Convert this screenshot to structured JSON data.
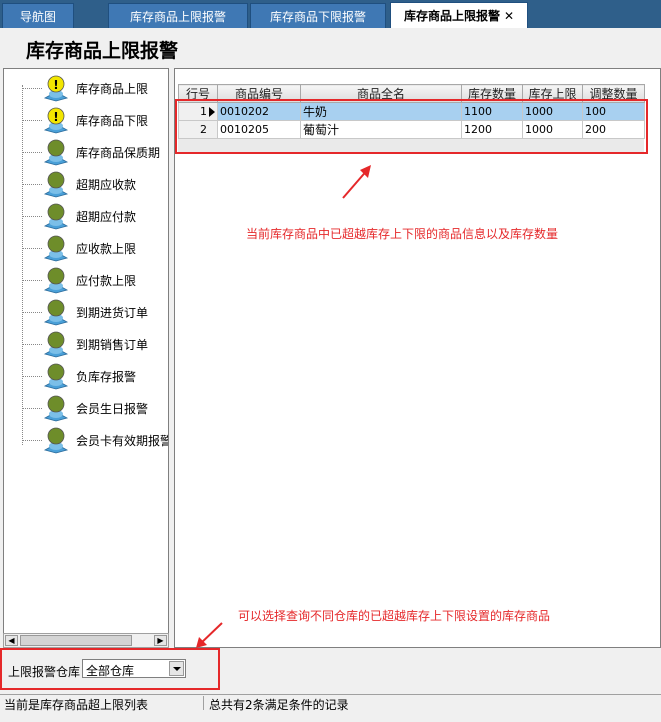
{
  "tabs": [
    {
      "label": "导航图"
    },
    {
      "label": "库存商品上限报警"
    },
    {
      "label": "库存商品下限报警"
    },
    {
      "label": "库存商品上限报警",
      "close": "✕"
    }
  ],
  "page_title": "库存商品上限报警",
  "tree": {
    "items": [
      {
        "label": "库存商品上限",
        "icon": "warning-person-icon"
      },
      {
        "label": "库存商品下限",
        "icon": "warning-person-icon"
      },
      {
        "label": "库存商品保质期",
        "icon": "person-icon"
      },
      {
        "label": "超期应收款",
        "icon": "person-icon"
      },
      {
        "label": "超期应付款",
        "icon": "person-icon"
      },
      {
        "label": "应收款上限",
        "icon": "person-icon"
      },
      {
        "label": "应付款上限",
        "icon": "person-icon"
      },
      {
        "label": "到期进货订单",
        "icon": "person-icon"
      },
      {
        "label": "到期销售订单",
        "icon": "person-icon"
      },
      {
        "label": "负库存报警",
        "icon": "person-icon"
      },
      {
        "label": "会员生日报警",
        "icon": "person-icon"
      },
      {
        "label": "会员卡有效期报警",
        "icon": "person-icon"
      }
    ]
  },
  "grid": {
    "columns": [
      "行号",
      "商品编号",
      "商品全名",
      "库存数量",
      "库存上限",
      "调整数量"
    ],
    "rows": [
      {
        "row_no": "1",
        "code": "0010202",
        "name": "牛奶",
        "qty": "1100",
        "limit": "1000",
        "adjust": "100",
        "selected": true
      },
      {
        "row_no": "2",
        "code": "0010205",
        "name": "葡萄汁",
        "qty": "1200",
        "limit": "1000",
        "adjust": "200",
        "selected": false
      }
    ]
  },
  "annotations": {
    "grid_note": "当前库存商品中已超越库存上下限的商品信息以及库存数量",
    "filter_note": "可以选择查询不同仓库的已超越库存上下限设置的库存商品"
  },
  "filter": {
    "label": "上限报警仓库",
    "value": "全部仓库"
  },
  "status": {
    "left": "当前是库存商品超上限列表",
    "right": "总共有2条满足条件的记录"
  },
  "colors": {
    "annotation_red": "#e5282a",
    "tab_bar": "#2f5f8a",
    "tab": "#3f78b4",
    "selected_row": "#a8d0f0"
  }
}
